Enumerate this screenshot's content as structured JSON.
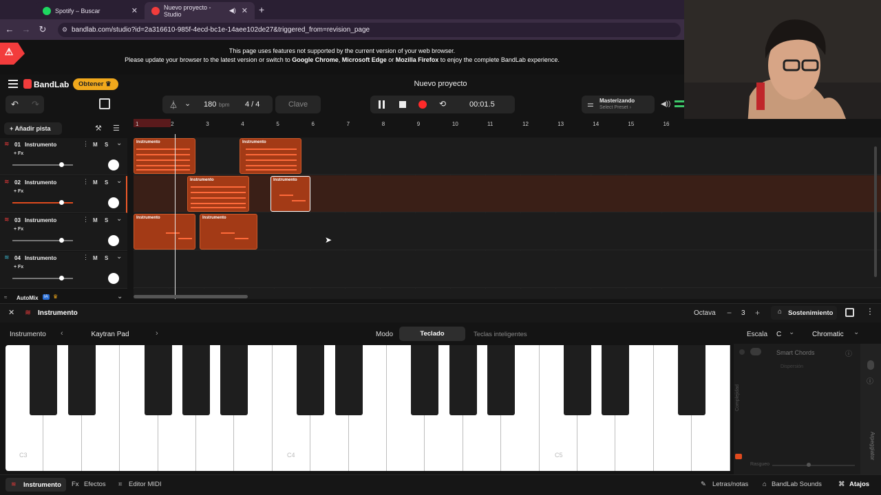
{
  "browser": {
    "tabs": [
      {
        "label": "Spotify – Buscar"
      },
      {
        "label": "Nuevo proyecto - Studio"
      }
    ],
    "new_tab": "+",
    "url": "bandlab.com/studio?id=2a316610-985f-4ecd-bc1e-14aee102de27&triggered_from=revision_page"
  },
  "warning": {
    "line1": "This page uses features not supported by the current version of your web browser.",
    "line2_pre": "Please update your browser to the latest version or switch to ",
    "chrome": "Google Chrome",
    "sep1": ", ",
    "edge": "Microsoft Edge",
    "sep2": " or ",
    "firefox": "Mozilla Firefox",
    "line2_post": " to enjoy the complete BandLab experience."
  },
  "app": {
    "logo": "BandLab",
    "obtener": "Obtener",
    "project_title": "Nuevo proyecto",
    "tempo": "180",
    "tempo_unit": "bpm",
    "time_sig": "4 / 4",
    "key": "Clave",
    "time": "00:01.5",
    "mastering_title": "Masterizando",
    "mastering_sub": "Select Preset ›"
  },
  "tracks_panel": {
    "add_track": "Añadir pista",
    "automix": "AutoMix",
    "ia_badge": "IA",
    "tracks": [
      {
        "num": "01",
        "name": "Instrumento",
        "fx": "+ Fx",
        "m": "M",
        "s": "S",
        "volume": 0.82
      },
      {
        "num": "02",
        "name": "Instrumento",
        "fx": "+ Fx",
        "m": "M",
        "s": "S",
        "volume": 0.82
      },
      {
        "num": "03",
        "name": "Instrumento",
        "fx": "+ Fx",
        "m": "M",
        "s": "S",
        "volume": 0.82
      },
      {
        "num": "04",
        "name": "Instrumento",
        "fx": "+ Fx",
        "m": "M",
        "s": "S",
        "volume": 0.82
      }
    ]
  },
  "ruler": [
    "1",
    "2",
    "3",
    "4",
    "5",
    "6",
    "7",
    "8",
    "9",
    "10",
    "11",
    "12",
    "13",
    "14",
    "15",
    "16"
  ],
  "clip_label": "Instrumento",
  "instrument_panel": {
    "title": "Instrumento",
    "octave_label": "Octava",
    "octave_value": "3",
    "minus": "−",
    "plus": "+",
    "sustain": "Sostenimiento",
    "instrument_label": "Instrumento",
    "preset": "Kaytran Pad",
    "mode_label": "Modo",
    "mode_keyboard": "Teclado",
    "mode_smart": "Teclas inteligentes",
    "scale_label": "Escala",
    "scale_key": "C",
    "scale_type": "Chromatic",
    "smart_chords": "Smart Chords",
    "dispersion": "Dispersión",
    "complexity": "Complejidad",
    "arpeggiator": "Arpeggiator",
    "rasgueo": "Rasgueo",
    "key_c3": "C3",
    "key_c4": "C4",
    "key_c5": "C5"
  },
  "footer": {
    "instrument": "Instrumento",
    "effects": "Efectos",
    "midi": "Editor MIDI",
    "lyrics": "Letras/notas",
    "sounds": "BandLab Sounds",
    "shortcuts": "Atajos"
  },
  "colors": {
    "accent": "#f23c3c",
    "clip": "#a33a16",
    "obtener": "#f0a81c",
    "record": "#ff2a2a"
  }
}
